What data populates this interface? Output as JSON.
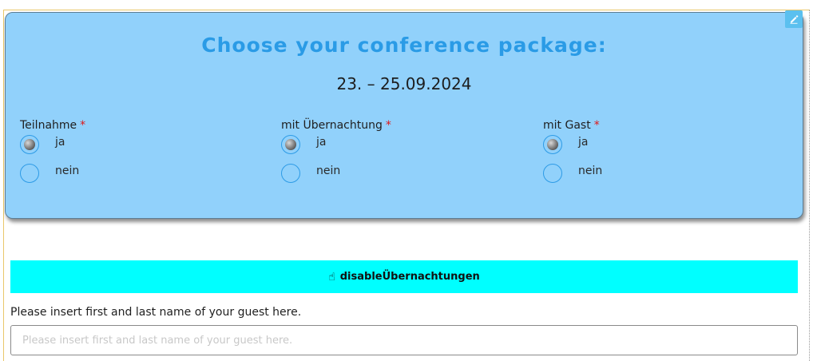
{
  "card": {
    "title": "Choose your conference package:",
    "date": "23. – 25.09.2024",
    "edit_icon": "pencil-icon"
  },
  "groups": [
    {
      "label": "Teilnahme",
      "required_mark": "*",
      "options": [
        {
          "label": "ja",
          "checked": true
        },
        {
          "label": "nein",
          "checked": false
        }
      ]
    },
    {
      "label": "mit Übernachtung",
      "required_mark": "*",
      "options": [
        {
          "label": "ja",
          "checked": true
        },
        {
          "label": "nein",
          "checked": false
        }
      ]
    },
    {
      "label": "mit Gast",
      "required_mark": "*",
      "options": [
        {
          "label": "ja",
          "checked": true
        },
        {
          "label": "nein",
          "checked": false
        }
      ]
    }
  ],
  "disable_button": {
    "label": "disableÜbernachtungen",
    "icon": "pointing-hand-icon"
  },
  "guest": {
    "label": "Please insert first and last name of your guest here.",
    "placeholder": "Please insert first and last name of your guest here."
  }
}
